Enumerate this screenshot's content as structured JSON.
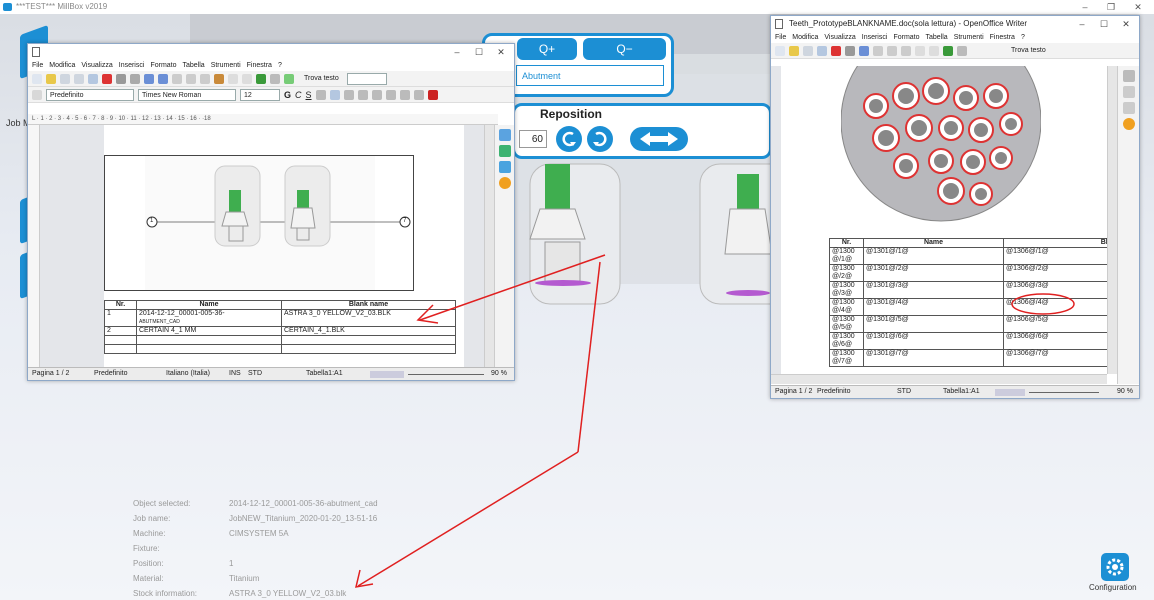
{
  "app": {
    "title": "***TEST*** MillBox v2019",
    "minimize": "–",
    "maximize": "❐",
    "close": "✕"
  },
  "left_rail": {
    "job_label": "Job M"
  },
  "zoom_buttons": {
    "zoom_in": "Q+",
    "zoom_out": "Q−"
  },
  "element_field": {
    "value": "Abutment"
  },
  "reposition": {
    "title": "Reposition",
    "angle": "60"
  },
  "writer_left": {
    "minimize": "–",
    "maximize": "☐",
    "close": "✕",
    "menu": [
      "File",
      "Modifica",
      "Visualizza",
      "Inserisci",
      "Formato",
      "Tabella",
      "Strumenti",
      "Finestra",
      "?"
    ],
    "find_label": "Trova testo",
    "style": "Predefinito",
    "font": "Times New Roman",
    "size": "12",
    "fmt": {
      "bold": "G",
      "italic": "C",
      "underline": "S"
    },
    "ruler": "L · 1 · 2 · 3 · 4 · 5 · 6 · 7 · 8 · 9 · 10 · 11 · 12 · 13 · 14 · 15 · 16 · ·18",
    "marker_left": "1",
    "marker_right": "7",
    "table": {
      "headers": [
        "Nr.",
        "Name",
        "Blank name"
      ],
      "rows": [
        {
          "nr": "1",
          "name": "2014-12-12_00001-005-36-",
          "name2": "ABUTMENT_CAD",
          "blank": "ASTRA 3_0 YELLOW_V2_03.BLK"
        },
        {
          "nr": "2",
          "name": "CERTAIN 4_1 MM",
          "name2": "",
          "blank": "CERTAIN_4_1.BLK"
        }
      ]
    },
    "status": {
      "page": "Pagina 1 / 2",
      "style": "Predefinito",
      "lang": "Italiano (Italia)",
      "ins": "INS",
      "std": "STD",
      "cell": "Tabella1:A1",
      "zoom": "90 %"
    }
  },
  "writer_right": {
    "title": "Teeth_PrototypeBLANKNAME.doc(sola lettura) - OpenOffice Writer",
    "minimize": "–",
    "maximize": "☐",
    "close": "✕",
    "menu": [
      "File",
      "Modifica",
      "Visualizza",
      "Inserisci",
      "Formato",
      "Tabella",
      "Strumenti",
      "Finestra",
      "?"
    ],
    "find_label": "Trova testo",
    "table": {
      "headers": [
        "Nr.",
        "Name",
        "Blank n"
      ],
      "rows": [
        {
          "nr": "@1300",
          "nr2": "@/1@",
          "name": "@1301@/1@",
          "blank": "@1306@/1@"
        },
        {
          "nr": "@1300",
          "nr2": "@/2@",
          "name": "@1301@/2@",
          "blank": "@1306@/2@"
        },
        {
          "nr": "@1300",
          "nr2": "@/3@",
          "name": "@1301@/3@",
          "blank": "@1306@/3@"
        },
        {
          "nr": "@1300",
          "nr2": "@/4@",
          "name": "@1301@/4@",
          "blank": "@1306@/4@"
        },
        {
          "nr": "@1300",
          "nr2": "@/5@",
          "name": "@1301@/5@",
          "blank": "@1306@/5@"
        },
        {
          "nr": "@1300",
          "nr2": "@/6@",
          "name": "@1301@/6@",
          "blank": "@1306@/6@"
        },
        {
          "nr": "@1300",
          "nr2": "@/7@",
          "name": "@1301@/7@",
          "blank": "@1306@/7@"
        }
      ]
    },
    "status": {
      "page": "Pagina 1 / 2",
      "style": "Predefinito",
      "std": "STD",
      "cell": "Tabella1:A1",
      "zoom": "90 %"
    }
  },
  "info": [
    {
      "k": "Object selected:",
      "v": "2014-12-12_00001-005-36-abutment_cad"
    },
    {
      "k": "Job name:",
      "v": "JobNEW_Titanium_2020-01-20_13-51-16"
    },
    {
      "k": "Machine:",
      "v": "CIMSYSTEM 5A"
    },
    {
      "k": "Fixture:",
      "v": ""
    },
    {
      "k": "Position:",
      "v": "1"
    },
    {
      "k": "Material:",
      "v": "Titanium"
    },
    {
      "k": "Stock information:",
      "v": "ASTRA 3_0 YELLOW_V2_03.blk"
    }
  ],
  "configuration": {
    "label": "Configuration"
  },
  "colors": {
    "accent": "#1c8fd4",
    "annotation": "#e02020"
  }
}
